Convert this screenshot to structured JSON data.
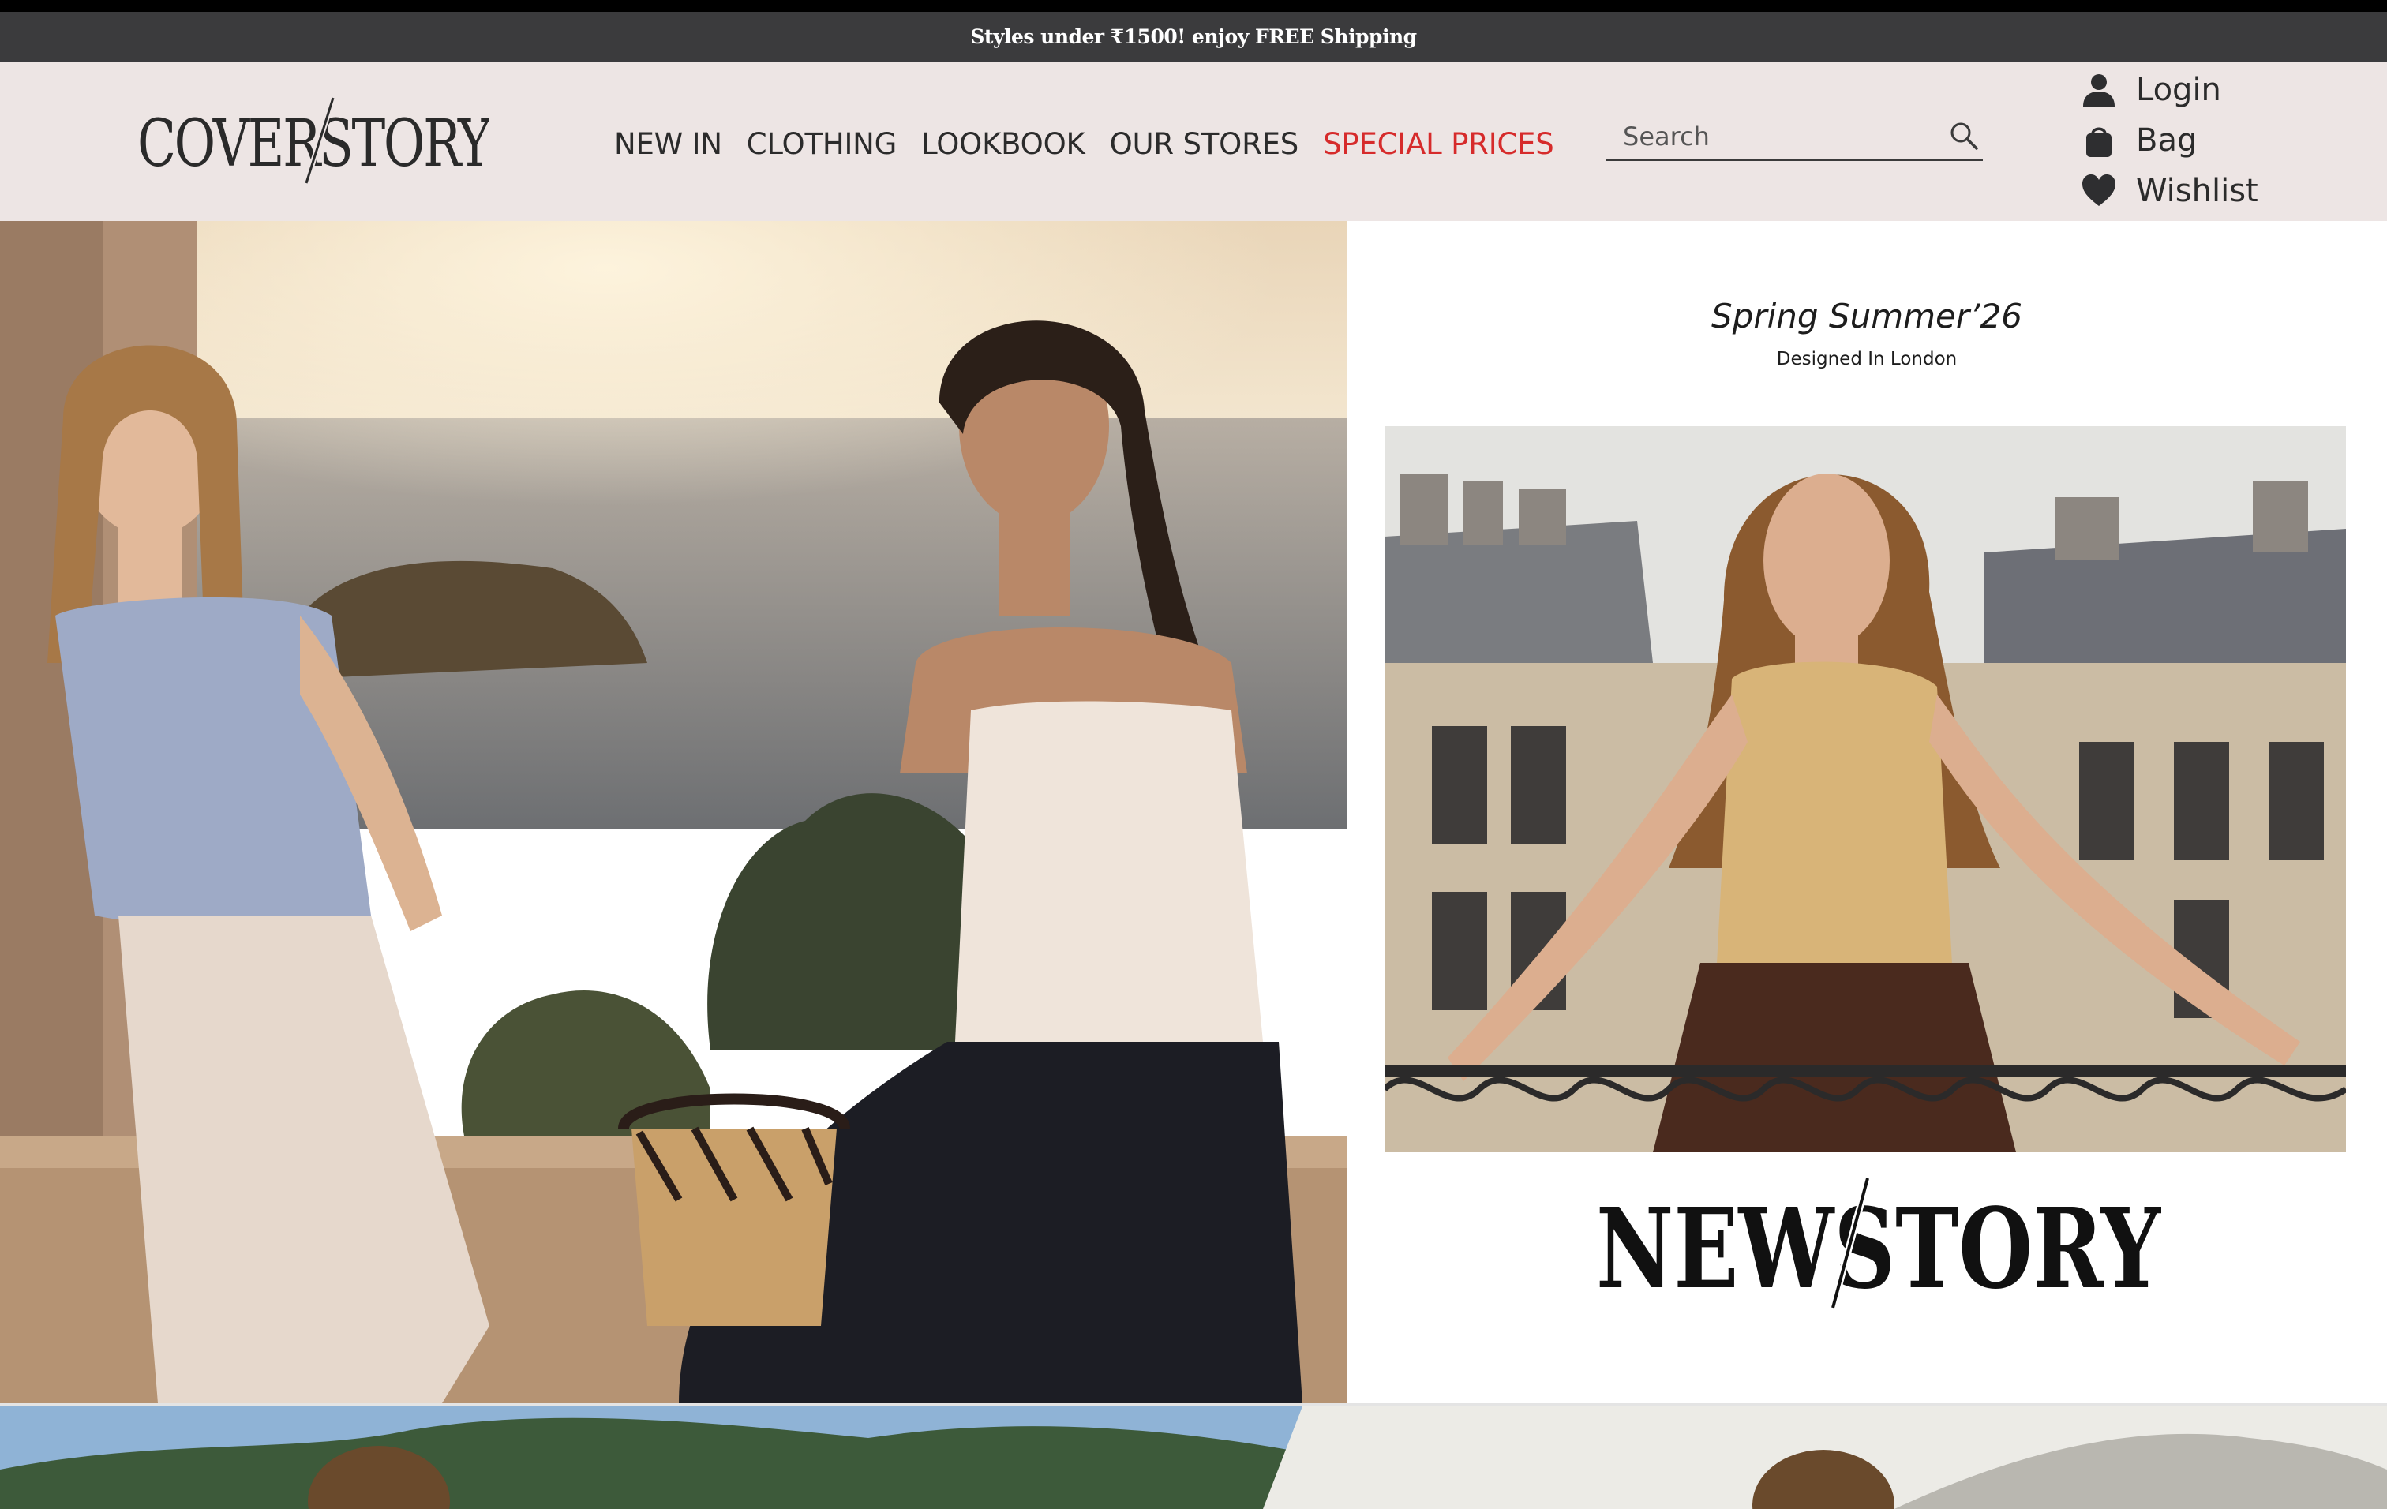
{
  "promo": {
    "text": "Styles under ₹1500! enjoy FREE Shipping"
  },
  "header": {
    "logo_text": "COVERSTORY",
    "nav": [
      {
        "label": "NEW IN"
      },
      {
        "label": "CLOTHING"
      },
      {
        "label": "LOOKBOOK"
      },
      {
        "label": "OUR STORES"
      },
      {
        "label": "SPECIAL PRICES"
      }
    ],
    "search": {
      "placeholder": "Search",
      "icon": "search-icon"
    },
    "account": {
      "login": {
        "label": "Login",
        "icon": "user-icon"
      },
      "bag": {
        "label": "Bag",
        "icon": "bag-icon"
      },
      "wishlist": {
        "label": "Wishlist",
        "icon": "heart-icon"
      }
    }
  },
  "hero": {
    "season_title": "Spring Summer’26",
    "season_subtitle": "Designed In London",
    "collection_logo_text": "NEWSTORY"
  },
  "colors": {
    "promo_bg": "#3b3b3d",
    "header_bg": "#ede5e4",
    "special_prices": "#d62b2b",
    "text": "#2b2b2b"
  }
}
